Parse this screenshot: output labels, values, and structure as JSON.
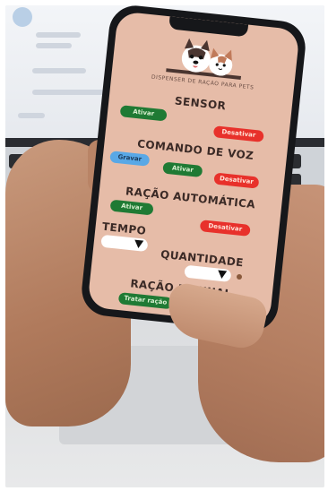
{
  "app": {
    "logo_text": "DISPENSER DE RAÇÃO PARA PETS"
  },
  "sensor": {
    "title": "SENSOR",
    "activate_label": "Ativar",
    "deactivate_label": "Desativar"
  },
  "voice_command": {
    "title": "COMANDO DE VOZ",
    "record_label": "Gravar",
    "activate_label": "Ativar",
    "deactivate_label": "Desativar"
  },
  "auto_feed": {
    "title": "RAÇÃO AUTOMÁTICA",
    "activate_label": "Ativar",
    "deactivate_label": "Desativar",
    "time_label": "TEMPO",
    "quantity_label": "QUANTIDADE",
    "time_value": "",
    "quantity_value": ""
  },
  "manual_feed": {
    "title": "RAÇÃO MANUAL",
    "dispense_label": "Tratar ração"
  },
  "colors": {
    "screen_background": "#e6bca8",
    "activate_green": "#1f7a34",
    "deactivate_red": "#e8312b",
    "record_blue": "#59a8e6"
  },
  "icons": {
    "logo": "dog-and-cat-logo-icon",
    "dropdown": "triangle-down-icon"
  }
}
